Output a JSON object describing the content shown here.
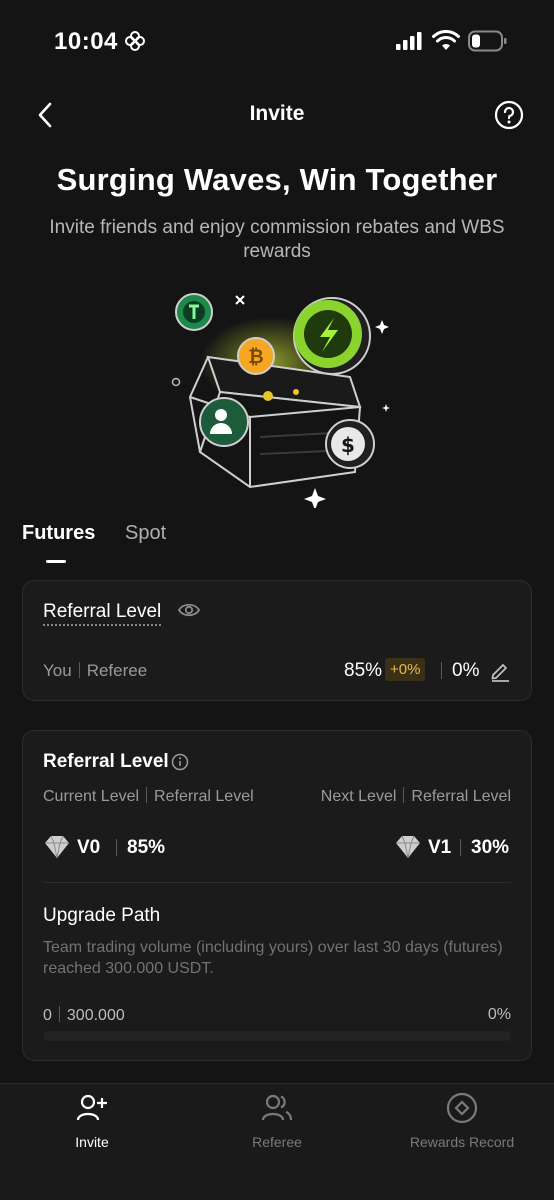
{
  "status_bar": {
    "time": "10:04"
  },
  "header": {
    "title": "Invite"
  },
  "hero": {
    "title": "Surging Waves, Win Together",
    "subtitle": "Invite friends and enjoy commission rebates and WBS rewards"
  },
  "tabs": [
    {
      "label": "Futures",
      "active": true
    },
    {
      "label": "Spot",
      "active": false
    }
  ],
  "referral_card": {
    "title": "Referral Level",
    "you_label": "You",
    "referee_label": "Referee",
    "you_rate": "85%",
    "bonus_rate": "+0%",
    "referee_rate": "0%"
  },
  "level_card": {
    "title": "Referral Level",
    "current_label": "Current Level",
    "current_sub_label": "Referral Level",
    "next_label": "Next Level",
    "next_sub_label": "Referral Level",
    "current_level": "V0",
    "current_rate": "85%",
    "next_level": "V1",
    "next_rate": "30%",
    "upgrade_title": "Upgrade Path",
    "upgrade_desc": "Team trading volume (including yours) over last 30 days (futures) reached 300.000 USDT.",
    "progress_current": "0",
    "progress_target": "300.000",
    "progress_percent": "0%",
    "progress_value": 0
  },
  "bottom_nav": [
    {
      "label": "Invite",
      "icon": "add-user-icon",
      "active": true
    },
    {
      "label": "Referee",
      "icon": "users-icon",
      "active": false
    },
    {
      "label": "Rewards Record",
      "icon": "target-icon",
      "active": false
    }
  ],
  "colors": {
    "background": "#141414",
    "card": "#1b1b1b",
    "accent": "#c8ff2e",
    "bonus": "#f0b84a"
  }
}
